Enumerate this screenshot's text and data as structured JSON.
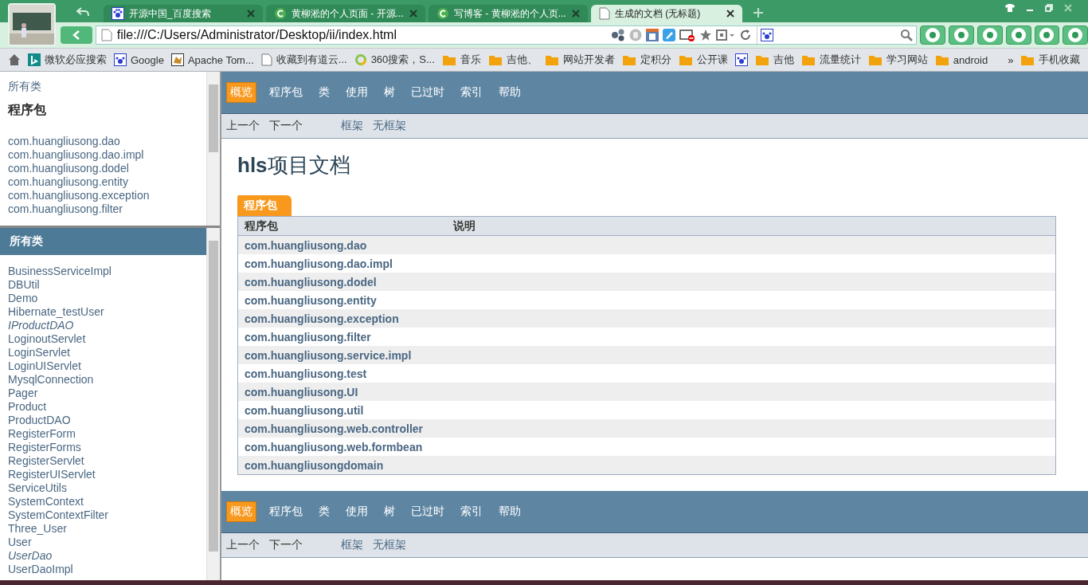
{
  "browser": {
    "tabs": [
      {
        "title": "开源中国_百度搜索",
        "kind": "paw",
        "selected": false
      },
      {
        "title": "黄柳淞的个人页面 - 开源...",
        "kind": "c",
        "selected": false
      },
      {
        "title": "写博客 - 黄柳淞的个人页...",
        "kind": "c",
        "selected": false
      },
      {
        "title": "生成的文档 (无标题)",
        "kind": "page",
        "selected": true
      }
    ],
    "address": "file:///C:/Users/Administrator/Desktop/ii/index.html",
    "bookmarks": [
      {
        "label": "微软必应搜索",
        "kind": "bing"
      },
      {
        "label": "Google",
        "kind": "paw"
      },
      {
        "label": "Apache Tom...",
        "kind": "cat"
      },
      {
        "label": "收藏到有道云...",
        "kind": "page"
      },
      {
        "label": "360搜索，S...",
        "kind": "ring"
      },
      {
        "label": "音乐",
        "kind": "folder"
      },
      {
        "label": "吉他、",
        "kind": "folder"
      },
      {
        "label": "网站开发者",
        "kind": "folder"
      },
      {
        "label": "定积分",
        "kind": "folder"
      },
      {
        "label": "公开课",
        "kind": "folder"
      },
      {
        "kind": "paw"
      },
      {
        "label": "吉他",
        "kind": "folder"
      },
      {
        "label": "流量统计",
        "kind": "folder"
      },
      {
        "label": "学习网站",
        "kind": "folder"
      },
      {
        "label": "android",
        "kind": "folder"
      }
    ],
    "overflow": "»",
    "last_bookmark": "手机收藏"
  },
  "package_frame": {
    "link": "所有类",
    "heading": "程序包",
    "packages": [
      "com.huangliusong.dao",
      "com.huangliusong.dao.impl",
      "com.huangliusong.dodel",
      "com.huangliusong.entity",
      "com.huangliusong.exception",
      "com.huangliusong.filter"
    ]
  },
  "class_frame": {
    "heading": "所有类",
    "classes": [
      {
        "name": "BusinessServiceImpl",
        "kind": "class"
      },
      {
        "name": "DBUtil",
        "kind": "class"
      },
      {
        "name": "Demo",
        "kind": "class"
      },
      {
        "name": "Hibernate_testUser",
        "kind": "class"
      },
      {
        "name": "IProductDAO",
        "kind": "interface"
      },
      {
        "name": "LoginoutServlet",
        "kind": "class"
      },
      {
        "name": "LoginServlet",
        "kind": "class"
      },
      {
        "name": "LoginUIServlet",
        "kind": "class"
      },
      {
        "name": "MysqlConnection",
        "kind": "class"
      },
      {
        "name": "Pager",
        "kind": "class"
      },
      {
        "name": "Product",
        "kind": "class"
      },
      {
        "name": "ProductDAO",
        "kind": "class"
      },
      {
        "name": "RegisterForm",
        "kind": "class"
      },
      {
        "name": "RegisterForms",
        "kind": "class"
      },
      {
        "name": "RegisterServlet",
        "kind": "class"
      },
      {
        "name": "RegisterUIServlet",
        "kind": "class"
      },
      {
        "name": "ServiceUtils",
        "kind": "class"
      },
      {
        "name": "SystemContext",
        "kind": "class"
      },
      {
        "name": "SystemContextFilter",
        "kind": "class"
      },
      {
        "name": "Three_User",
        "kind": "class"
      },
      {
        "name": "User",
        "kind": "class"
      },
      {
        "name": "UserDao",
        "kind": "interface"
      },
      {
        "name": "UserDaoImpl",
        "kind": "class"
      }
    ]
  },
  "main": {
    "top_nav": [
      {
        "label": "概览",
        "selected": true
      },
      {
        "label": "程序包",
        "selected": false
      },
      {
        "label": "类",
        "selected": false
      },
      {
        "label": "使用",
        "selected": false
      },
      {
        "label": "树",
        "selected": false
      },
      {
        "label": "已过时",
        "selected": false
      },
      {
        "label": "索引",
        "selected": false
      },
      {
        "label": "帮助",
        "selected": false
      }
    ],
    "sub_nav": [
      "上一个",
      "下一个"
    ],
    "frame_links": [
      "框架",
      "无框架"
    ],
    "title": "**hls**项目文档",
    "table": {
      "caption": "程序包",
      "columns": [
        "程序包",
        "说明"
      ],
      "rows": [
        "com.huangliusong.dao",
        "com.huangliusong.dao.impl",
        "com.huangliusong.dodel",
        "com.huangliusong.entity",
        "com.huangliusong.exception",
        "com.huangliusong.filter",
        "com.huangliusong.service.impl",
        "com.huangliusong.test",
        "com.huangliusong.UI",
        "com.huangliusong.util",
        "com.huangliusong.web.controller",
        "com.huangliusong.web.formbean",
        "com.huangliusongdomain"
      ]
    },
    "bottom_nav": [
      {
        "label": "概览",
        "selected": true
      },
      {
        "label": "程序包",
        "selected": false
      },
      {
        "label": "类",
        "selected": false
      },
      {
        "label": "使用",
        "selected": false
      },
      {
        "label": "树",
        "selected": false
      },
      {
        "label": "已过时",
        "selected": false
      },
      {
        "label": "索引",
        "selected": false
      },
      {
        "label": "帮助",
        "selected": false
      }
    ],
    "bottom_sub_nav": [
      "上一个",
      "下一个"
    ],
    "bottom_frame_links": [
      "框架",
      "无框架"
    ]
  }
}
